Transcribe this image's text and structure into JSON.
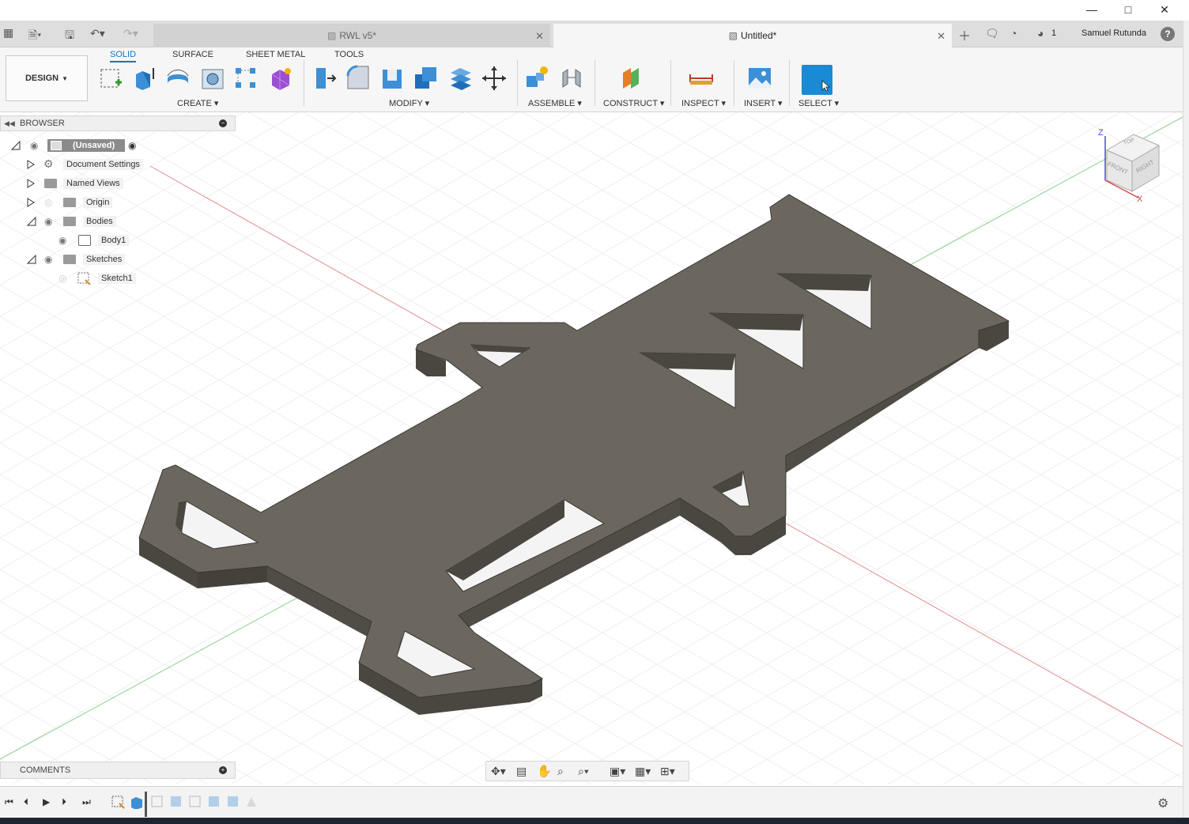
{
  "document_tabs": [
    {
      "label": "RWL v5*",
      "active": false
    },
    {
      "label": "Untitled*",
      "active": true
    }
  ],
  "header": {
    "job_count": "1",
    "user_name": "Samuel Rutunda",
    "help": "?"
  },
  "ribbon": {
    "workspace": "DESIGN",
    "tabs": [
      "SOLID",
      "SURFACE",
      "SHEET METAL",
      "TOOLS"
    ],
    "groups": [
      "CREATE",
      "MODIFY",
      "ASSEMBLE",
      "CONSTRUCT",
      "INSPECT",
      "INSERT",
      "SELECT"
    ]
  },
  "browser": {
    "title": "BROWSER",
    "root": "(Unsaved)",
    "items": [
      "Document Settings",
      "Named Views",
      "Origin",
      "Bodies",
      "Body1",
      "Sketches",
      "Sketch1"
    ]
  },
  "viewcube": {
    "top": "TOP",
    "front": "FRONT",
    "right": "RIGHT",
    "axis_z": "Z",
    "axis_x": "X"
  },
  "comments": {
    "title": "COMMENTS"
  },
  "colors": {
    "accent": "#0b76c6",
    "select_tile": "#1a8ad4",
    "body_top": "#6b675f",
    "body_side": "#4d4a44"
  }
}
